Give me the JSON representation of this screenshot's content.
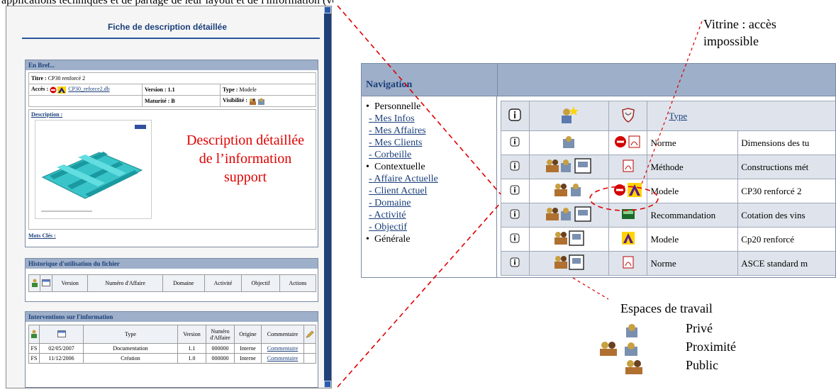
{
  "top_text": "applications techniques et de partage de leur layout et de l'information (voir figure ci-dessous)",
  "fiche": {
    "title": "Fiche de description détaillée",
    "en_bref": {
      "header": "En Bref...",
      "titre_label": "Titre :",
      "titre_value": "CP30 renforcé 2",
      "acces_label": "Accès :",
      "acces_file": "CP30_reforce2.db",
      "version_label": "Version : 1.1",
      "type_label": "Type :",
      "type_value": "Modele",
      "maturite_label": "Maturité : B",
      "visibilite_label": "Visibilité :",
      "description_label": "Description :",
      "mots_cles_label": "Mots Clés :"
    },
    "red_note": "Description détaillée de l’information support",
    "historique": {
      "header": "Historique d'utilisation du fichier",
      "columns": [
        "Version",
        "Numéro d'Affaire",
        "Domaine",
        "Activité",
        "Objectif",
        "Actions"
      ]
    },
    "interventions": {
      "header": "Interventions sur l'information",
      "columns": [
        "Type",
        "Version",
        "Numéro d'Affaire",
        "Origine",
        "Commentaire"
      ],
      "rows": [
        {
          "user": "FS",
          "date": "02/05/2007",
          "type": "Documentation",
          "version": "1.1",
          "affaire": "000000",
          "origine": "Interne",
          "commentaire": "Commentaire"
        },
        {
          "user": "FS",
          "date": "11/12/2006",
          "type": "Création",
          "version": "1.0",
          "affaire": "000000",
          "origine": "Interne",
          "commentaire": "Commentaire"
        }
      ]
    }
  },
  "navigation": {
    "title": "Navigation",
    "sections": [
      {
        "category": "Personnelle",
        "items": [
          "- Mes Infos",
          "- Mes Affaires",
          "- Mes Clients",
          "- Corbeille"
        ]
      },
      {
        "category": "Contextuelle",
        "items": [
          "- Affaire Actuelle",
          "- Client Actuel",
          "- Domaine",
          "- Activité",
          "- Objectif"
        ]
      },
      {
        "category": "Générale",
        "items": []
      }
    ],
    "type_header": "Type",
    "rows": [
      {
        "spaces": "private",
        "doc": "pdf-blocked",
        "type": "Norme",
        "name": "Dimensions des tu"
      },
      {
        "spaces": "proximity-pda",
        "doc": "pdf",
        "type": "Méthode",
        "name": "Constructions mét"
      },
      {
        "spaces": "proximity",
        "doc": "model-blocked",
        "type": "Modele",
        "name": "CP30 renforcé 2"
      },
      {
        "spaces": "proximity-pda",
        "doc": "gif",
        "type": "Recommandation",
        "name": "Cotation des vins"
      },
      {
        "spaces": "public-pda",
        "doc": "model",
        "type": "Modele",
        "name": "Cp20 renforcé"
      },
      {
        "spaces": "public-pda",
        "doc": "pdf",
        "type": "Norme",
        "name": "ASCE standard m"
      }
    ]
  },
  "annotations": {
    "vitrine": "Vitrine : accès impossible",
    "legend_title": "Espaces de travail",
    "legend": [
      "Privé",
      "Proximité",
      "Public"
    ]
  },
  "colors": {
    "header_blue": "#9eafc9",
    "link_blue": "#1a3f7a",
    "note_red": "#e00000",
    "scroll_blue": "#1e3f7a",
    "model_red": "#d40000",
    "model_yellow": "#ffd400"
  }
}
